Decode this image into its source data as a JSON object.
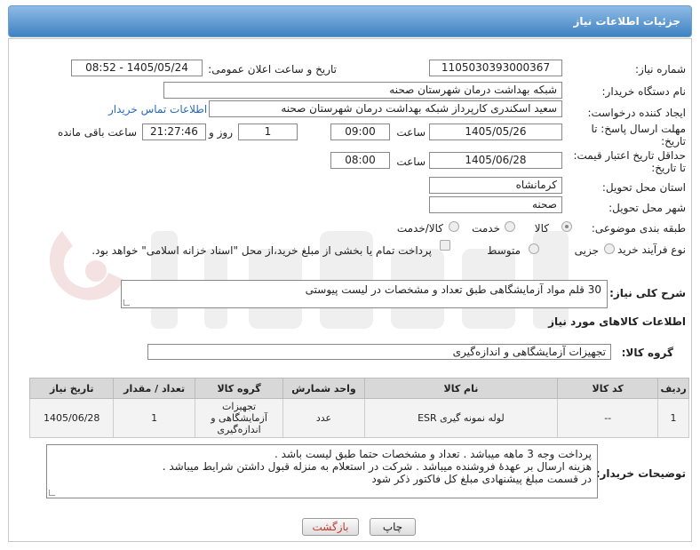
{
  "header": {
    "title": "جزئیات اطلاعات نیاز"
  },
  "fields": {
    "need_number_label": "شماره نیاز:",
    "need_number": "1105030393000367",
    "announce_label": "تاریخ و ساعت اعلان عمومی:",
    "announce_value": "1405/05/24 - 08:52",
    "buyer_org_label": "نام دستگاه خریدار:",
    "buyer_org": "شبکه بهداشت درمان شهرستان صحنه",
    "creator_label": "ایجاد کننده درخواست:",
    "creator": "سعید اسکندری کارپرداز شبکه بهداشت درمان شهرستان صحنه",
    "contact_link": "اطلاعات تماس خریدار",
    "deadline_label_1": "مهلت ارسال پاسخ: تا",
    "deadline_label_2": "تاریخ:",
    "deadline_date": "1405/05/26",
    "time_label": "ساعت",
    "deadline_time": "09:00",
    "days_value": "1",
    "days_label": "روز و",
    "remaining_time": "21:27:46",
    "remaining_label": "ساعت باقی مانده",
    "validity_label_1": "حداقل تاریخ اعتبار قیمت:",
    "validity_label_2": "تا تاریخ:",
    "validity_date": "1405/06/28",
    "validity_time": "08:00",
    "province_label": "استان محل تحویل:",
    "province": "کرمانشاه",
    "city_label": "شهر محل تحویل:",
    "city": "صحنه",
    "category_label": "طبقه بندی موضوعی:",
    "category_options": [
      "کالا",
      "خدمت",
      "کالا/خدمت"
    ],
    "process_label": "نوع فرآیند خرید :",
    "process_options": [
      "جزیی",
      "متوسط"
    ],
    "payment_note": "پرداخت تمام یا بخشی از مبلغ خرید،از محل \"اسناد خزانه اسلامی\" خواهد بود."
  },
  "summary": {
    "label": "شرح کلی نیاز:",
    "text": "30 قلم مواد آزمایشگاهی طبق تعداد و مشخصات در لیست پیوستی"
  },
  "goods_section": {
    "title": "اطلاعات کالاهای مورد نیاز",
    "group_label": "گروه کالا:",
    "group_value": "تجهیزات آزمایشگاهی و اندازه‌گیری"
  },
  "table": {
    "headers": [
      "ردیف",
      "کد کالا",
      "نام کالا",
      "واحد شمارش",
      "گروه کالا",
      "تعداد / مقدار",
      "تاریخ نیاز"
    ],
    "rows": [
      {
        "row": "1",
        "code": "--",
        "name": "لوله نمونه گیری ESR",
        "unit": "عدد",
        "group_l1": "تجهیزات",
        "group_l2": "آزمایشگاهی و",
        "group_l3": "اندازه‌گیری",
        "qty": "1",
        "date": "1405/06/28"
      }
    ]
  },
  "notes": {
    "label": "توضیحات خریدار:",
    "line1": "پرداخت وجه 3 ماهه میباشد . تعداد و مشخصات حتما طبق لیست باشد .",
    "line2": "هزینه ارسال بر عهدهٔ فروشنده میباشد . شرکت در استعلام به منزله قبول داشتن شرایط میباشد .",
    "line3": "در قسمت مبلغ پیشنهادی مبلغ کل فاکتور ذکر شود"
  },
  "buttons": {
    "print": "چاپ",
    "back": "بازگشت"
  },
  "colors": {
    "header_blue": "#3f82c3",
    "link_blue": "#2a6bb8",
    "back_red": "#c0392b"
  }
}
